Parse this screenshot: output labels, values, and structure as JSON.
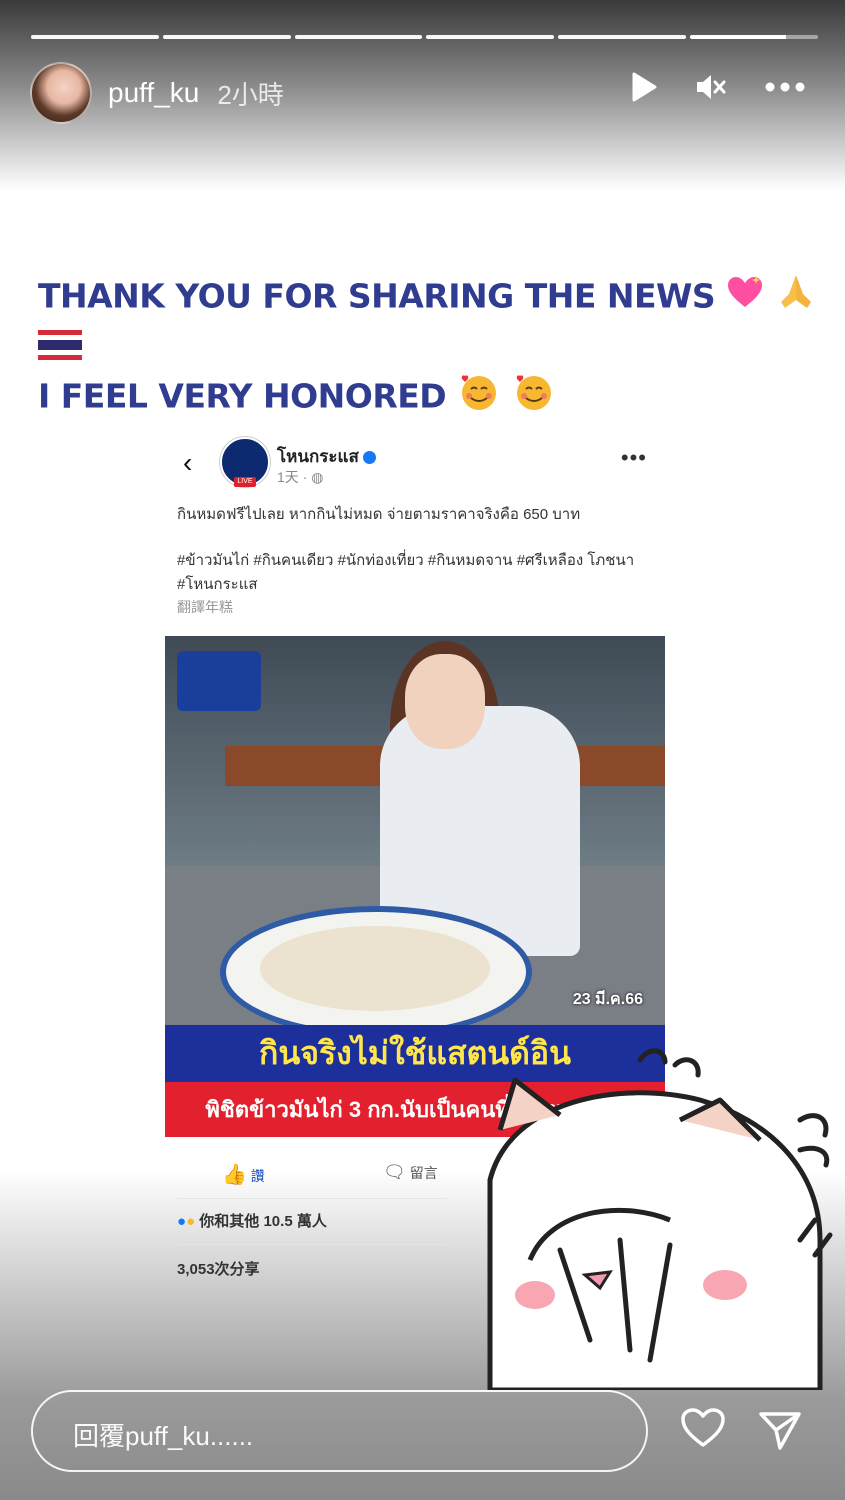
{
  "story": {
    "username": "puff_ku",
    "time_ago": "2小時",
    "progress_segments": 6,
    "current_segment_progress": 0.75
  },
  "caption": {
    "line1": "THANK YOU FOR SHARING THE NEWS",
    "line2": "I FEEL VERY HONORED"
  },
  "fb_post": {
    "page_name": "โหนกระแส",
    "time": "1天 · ",
    "text": "กินหมดฟรีไปเลย หากกินไม่หมด จ่ายตามราคาจริงคือ 650 บาท",
    "hashtags": "#ข้าวมันไก่ #กินคนเดียว #นักท่องเที่ยว #กินหมดจาน #ศรีเหลือง โภชนา #โหนกระแส",
    "translate": "翻譯年糕",
    "photo_date": "23 มี.ค.66",
    "banner_headline": "กินจริงไม่ใช้แสตนด์อิน",
    "banner_sub": "พิชิตข้าวมันไก่ 3 กก.นับเป็นคนที่ 37 ของร้าน",
    "like_label": "讚",
    "comment_label": "留言",
    "reactions_text": "你和其他 10.5 萬人",
    "shares_text": "3,053次分享"
  },
  "footer": {
    "reply_placeholder": "回覆puff_ku......"
  },
  "colors": {
    "caption": "#2f3c8f",
    "banner_blue": "#1d2f9b",
    "banner_yellow": "#ffe64d",
    "banner_red": "#e3212e"
  },
  "icons": [
    "play-icon",
    "mute-icon",
    "more-icon",
    "heart-icon",
    "send-icon"
  ]
}
